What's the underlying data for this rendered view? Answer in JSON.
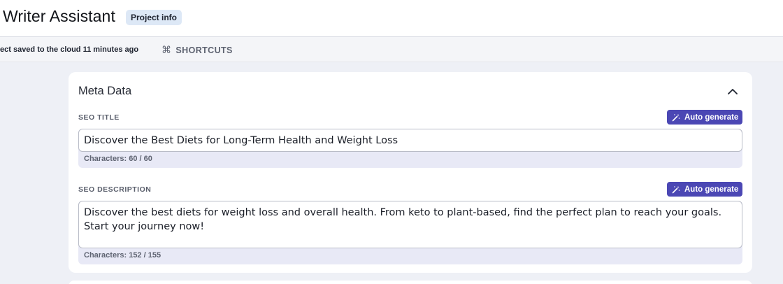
{
  "header": {
    "app_title": "Writer Assistant",
    "project_info_label": "Project info"
  },
  "subbar": {
    "save_status": "ect saved to the cloud 11 minutes ago",
    "shortcuts_icon": "⌘",
    "shortcuts_label": "SHORTCUTS"
  },
  "meta_card": {
    "title": "Meta Data",
    "collapse_icon": "chevron-up-icon",
    "seo_title": {
      "label": "SEO TITLE",
      "auto_generate_label": "Auto generate",
      "value": "Discover the Best Diets for Long-Term Health and Weight Loss",
      "counter": "Characters: 60 / 60"
    },
    "seo_description": {
      "label": "SEO DESCRIPTION",
      "auto_generate_label": "Auto generate",
      "value": "Discover the best diets for weight loss and overall health. From keto to plant-based, find the perfect plan to reach your goals. Start your journey now!",
      "counter": "Characters: 152 / 155"
    }
  },
  "colors": {
    "accent": "#4b47b4",
    "badge_bg": "#dde8f6",
    "page_bg": "#eef0f6"
  }
}
